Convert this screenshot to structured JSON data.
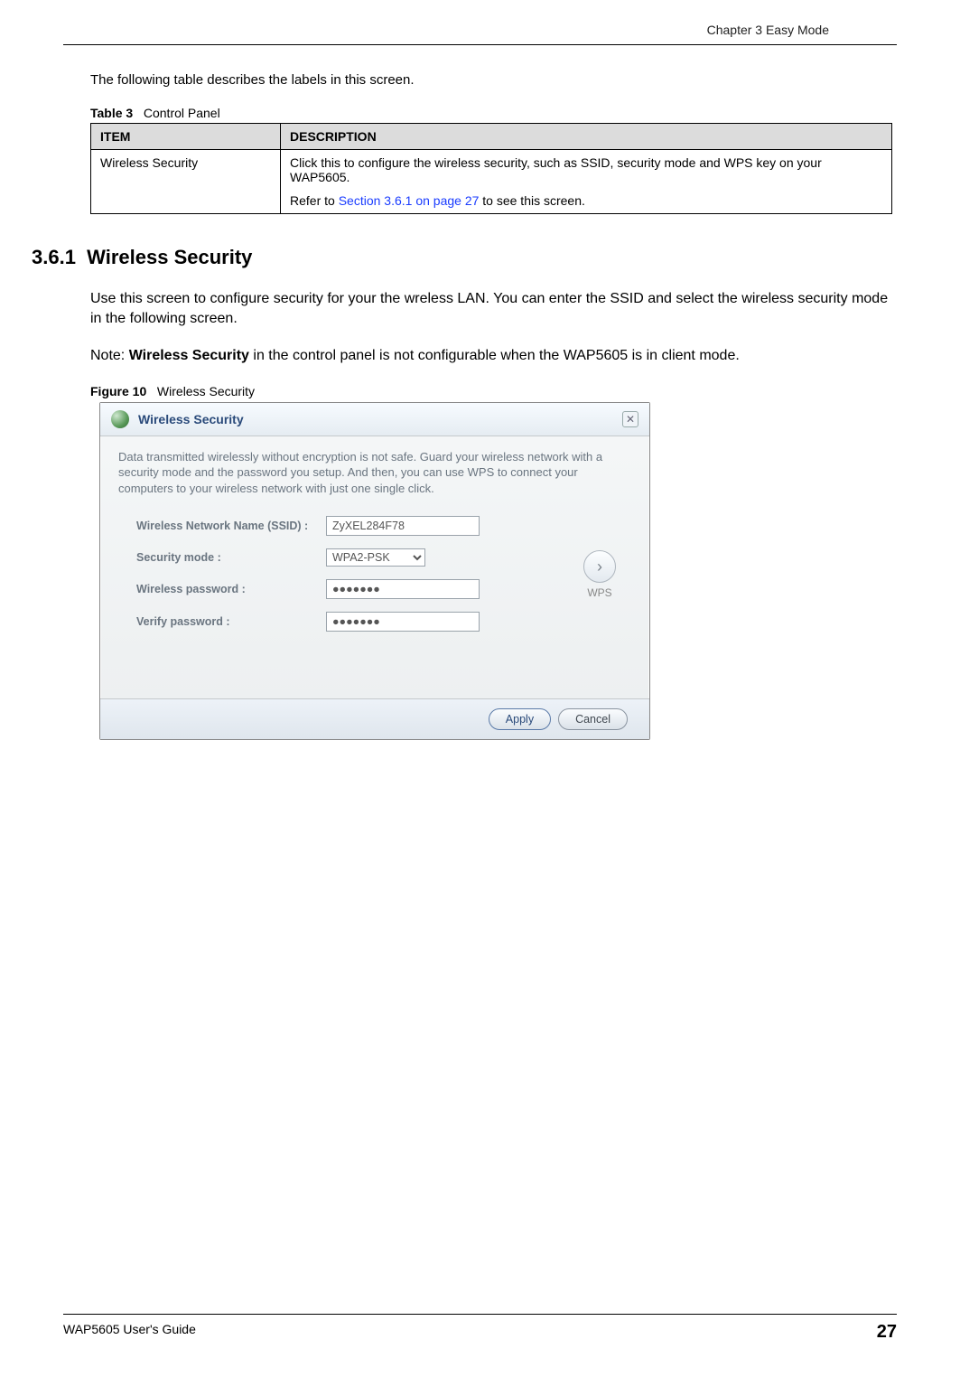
{
  "header": {
    "chapter": "Chapter 3 Easy Mode"
  },
  "intro": "The following table describes the labels in this screen.",
  "table": {
    "caption_label": "Table 3",
    "caption_text": "Control Panel",
    "head_item": "ITEM",
    "head_desc": "DESCRIPTION",
    "rows": [
      {
        "item": "Wireless Security",
        "desc1": "Click this to configure the wireless security, such as SSID, security mode and WPS key on your WAP5605.",
        "desc2a": "Refer to ",
        "desc2link": "Section 3.6.1 on page 27",
        "desc2b": " to see this screen."
      }
    ]
  },
  "section": {
    "number": "3.6.1",
    "title": "Wireless Security",
    "para": "Use this screen to configure security for your the wreless LAN. You can enter the SSID and select the wireless security mode in the following screen.",
    "note_prefix": "Note: ",
    "note_bold": "Wireless Security",
    "note_rest": " in the control panel is not configurable when the WAP5605 is in client mode."
  },
  "figure": {
    "caption_label": "Figure 10",
    "caption_text": "Wireless Security"
  },
  "dialog": {
    "title": "Wireless Security",
    "close": "✕",
    "intro": "Data transmitted wirelessly without encryption is not safe. Guard your wireless network with a security mode and the password you setup. And then, you can use WPS to connect your computers to your wireless network with just one single click.",
    "fields": {
      "ssid_label": "Wireless Network Name (SSID) :",
      "ssid_value": "ZyXEL284F78",
      "mode_label": "Security mode :",
      "mode_value": "WPA2-PSK",
      "pwd_label": "Wireless password :",
      "pwd_value": "●●●●●●●",
      "verify_label": "Verify password :",
      "verify_value": "●●●●●●●"
    },
    "wps_label": "WPS",
    "btn_apply": "Apply",
    "btn_cancel": "Cancel"
  },
  "footer": {
    "guide": "WAP5605 User's Guide",
    "page": "27"
  }
}
